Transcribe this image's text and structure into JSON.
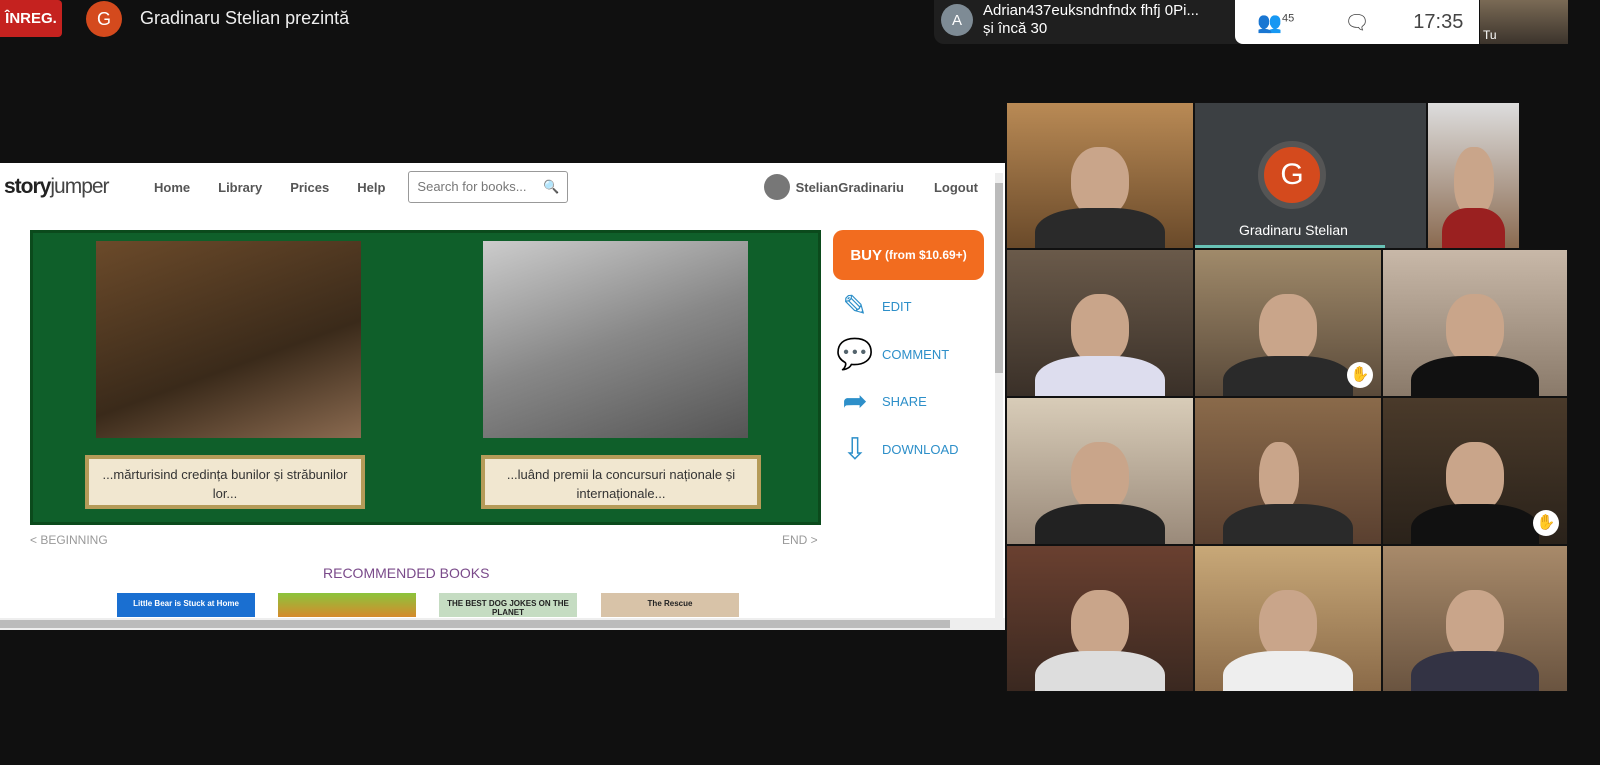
{
  "meet": {
    "recording_label": "ÎNREG.",
    "presenter_initial": "G",
    "presenter_title": "Gradinaru Stelian prezintă",
    "participant_initial": "A",
    "participant_name": "Adrian437euksndnfndx fhfj 0Pi...",
    "participant_more": "și încă 30",
    "people_count": "45",
    "time": "17:35",
    "self_label": "Tu",
    "people_icon": "people-icon",
    "chat_icon": "chat-icon"
  },
  "site": {
    "logo": "story",
    "logo2": "jumper",
    "nav": [
      "Home",
      "Library",
      "Prices",
      "Help"
    ],
    "search_placeholder": "Search for books...",
    "user": "StelianGradinariu",
    "logout": "Logout",
    "captions": [
      "...mărturisind credința bunilor și străbunilor lor...",
      "...luând premii la concursuri naționale și internaționale..."
    ],
    "buy": "BUY",
    "buy_price": "(from $10.69+)",
    "actions": [
      {
        "label": "EDIT",
        "icon": "pencil-icon"
      },
      {
        "label": "COMMENT",
        "icon": "comment-icon"
      },
      {
        "label": "SHARE",
        "icon": "share-icon"
      },
      {
        "label": "DOWNLOAD",
        "icon": "download-icon"
      }
    ],
    "beginning": "< BEGINNING",
    "end": "END >",
    "recommended": "RECOMMENDED BOOKS",
    "books": [
      "Little Bear is Stuck at Home",
      "",
      "THE BEST DOG JOKES ON THE PLANET",
      "The Rescue"
    ],
    "accent": "#f26c1f",
    "link": "#2d8fc9"
  },
  "grid": {
    "speaker_initial": "G",
    "speaker_name": "Gradinaru Stelian"
  }
}
